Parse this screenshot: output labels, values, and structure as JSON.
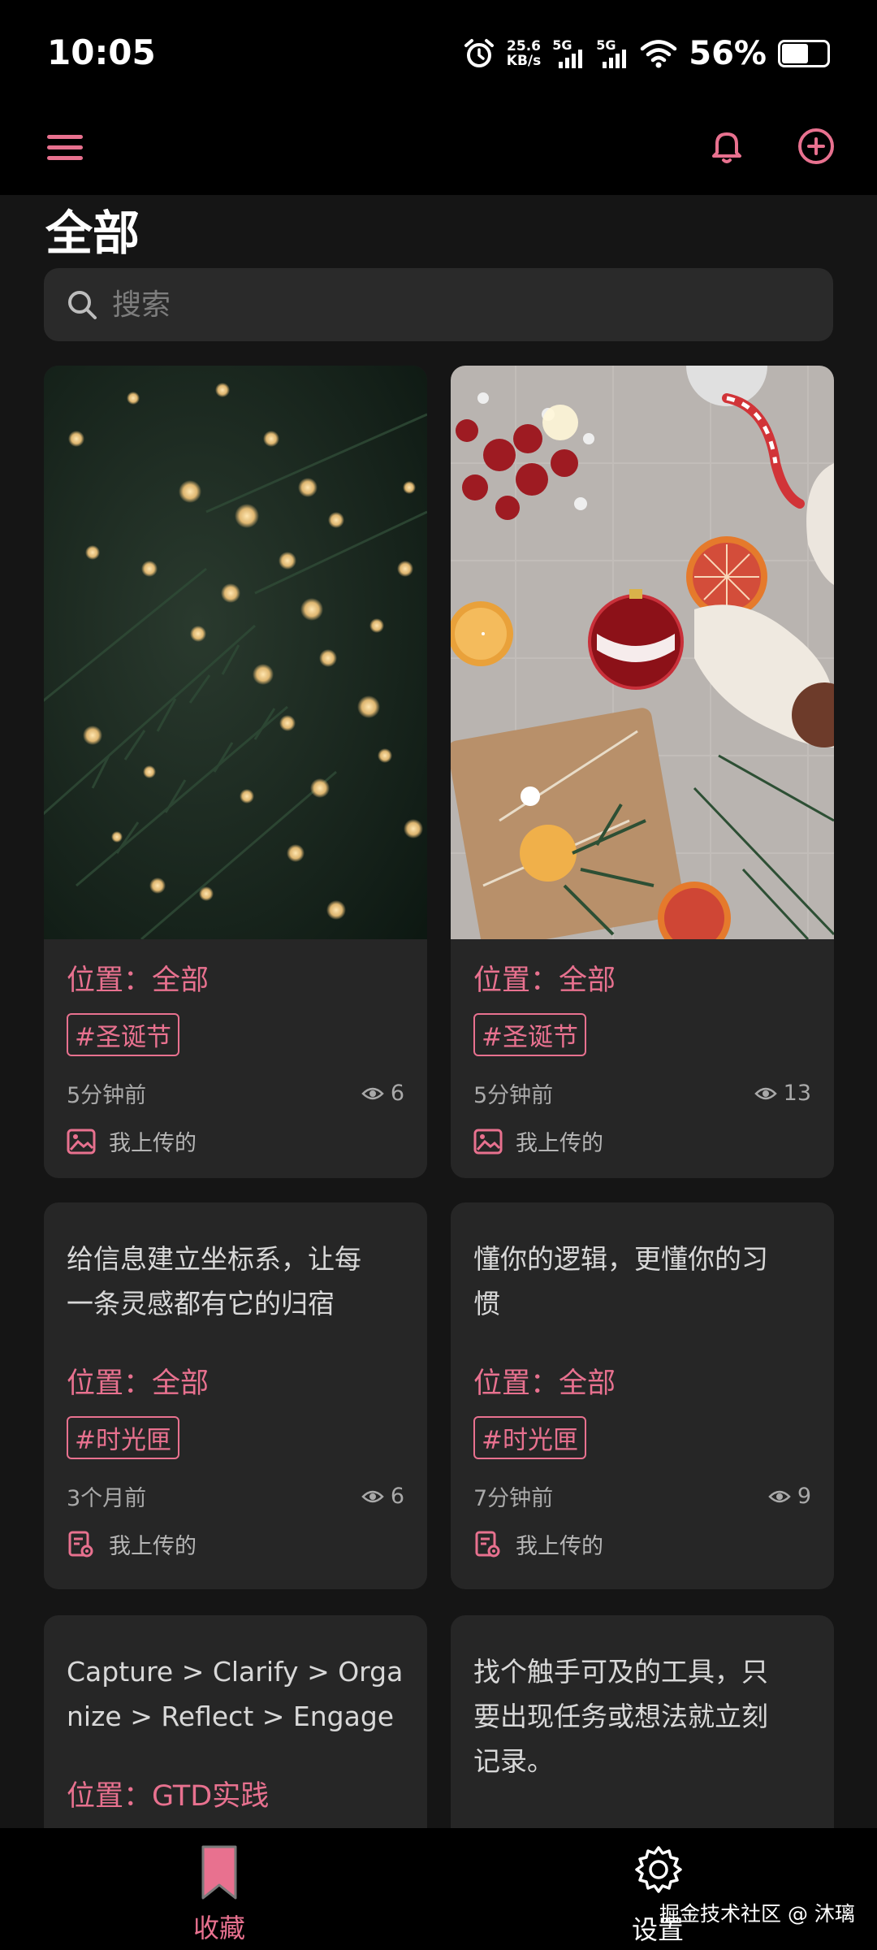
{
  "status_bar": {
    "time": "10:05",
    "net_speed_value": "25.6",
    "net_speed_unit": "KB/s",
    "sim1": "5G",
    "sim2": "5G",
    "battery": "56%",
    "battery_level": 0.56
  },
  "header": {
    "title": "全部"
  },
  "search": {
    "placeholder": "搜索"
  },
  "colors": {
    "accent": "#e8718f",
    "card": "#262626",
    "background": "#151515"
  },
  "cards": [
    {
      "location": "位置：全部",
      "tag": "#圣诞节",
      "time": "5分钟前",
      "views": "6",
      "source": "我上传的",
      "source_icon": "image-icon"
    },
    {
      "location": "位置：全部",
      "tag": "#圣诞节",
      "time": "5分钟前",
      "views": "13",
      "source": "我上传的",
      "source_icon": "image-icon"
    },
    {
      "text_line1": "给信息建立坐标系，让每",
      "text_line2": "一条灵感都有它的归宿",
      "location": "位置：全部",
      "tag": "#时光匣",
      "time": "3个月前",
      "views": "6",
      "source": "我上传的",
      "source_icon": "note-gear-icon"
    },
    {
      "text_line1": "懂你的逻辑，更懂你的习",
      "text_line2": "惯",
      "location": "位置：全部",
      "tag": "#时光匣",
      "time": "7分钟前",
      "views": "9",
      "source": "我上传的",
      "source_icon": "note-gear-icon"
    },
    {
      "text_line1": "Capture > Clarify > Orga",
      "text_line2": "nize > Reflect > Engage",
      "location": "位置：GTD实践"
    },
    {
      "text_line1": "找个触手可及的工具，只",
      "text_line2": "要出现任务或想法就立刻",
      "text_line3": "记录。"
    }
  ],
  "bottom_nav": {
    "favorites": "收藏",
    "settings": "设置"
  },
  "watermark": "掘金技术社区 @ 沐璃"
}
